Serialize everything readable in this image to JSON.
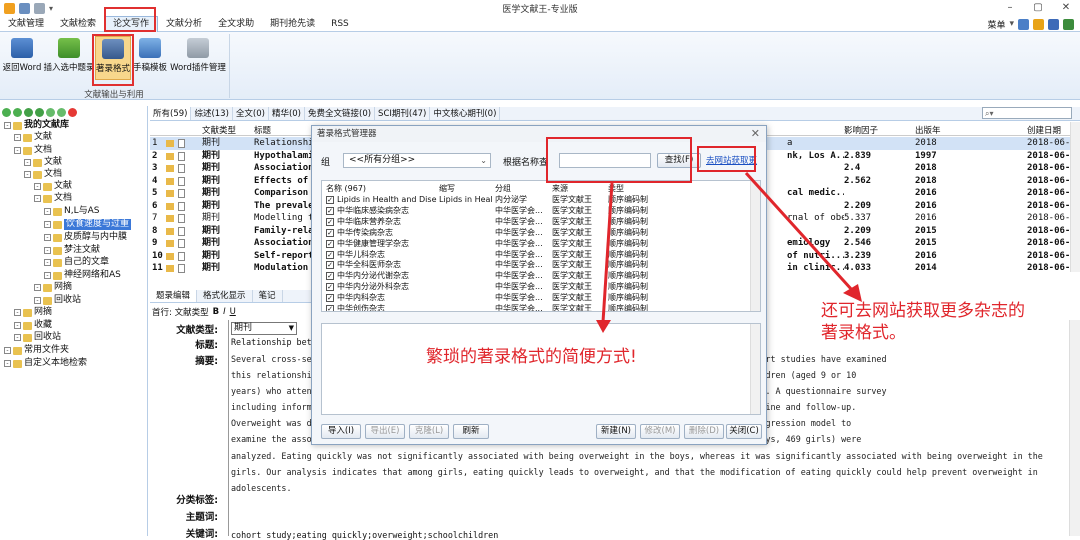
{
  "window": {
    "title": "医学文献王-专业版"
  },
  "menu": {
    "items": [
      "文献管理",
      "文献检索",
      "论文写作",
      "文献分析",
      "全文求助",
      "期刊抢先读",
      "RSS"
    ],
    "active": "论文写作",
    "right_label": "菜单"
  },
  "ribbon": {
    "buttons": [
      "返回Word",
      "插入选中题录",
      "著录格式",
      "手稿模板",
      "Word插件管理"
    ],
    "group_label": "文献输出与利用"
  },
  "sidebar": {
    "items": [
      {
        "label": "我的文献库",
        "level": 0,
        "bold": true
      },
      {
        "label": "文献",
        "level": 1
      },
      {
        "label": "文档",
        "level": 1
      },
      {
        "label": "文献",
        "level": 2
      },
      {
        "label": "文档",
        "level": 2
      },
      {
        "label": "文献",
        "level": 3
      },
      {
        "label": "文档",
        "level": 3
      },
      {
        "label": "N,L与AS",
        "level": 4
      },
      {
        "label": "饮食速度与过重",
        "level": 4,
        "selected": true
      },
      {
        "label": "皮质醇与内中膜",
        "level": 4
      },
      {
        "label": "梦注文献",
        "level": 4
      },
      {
        "label": "自己的文章",
        "level": 4
      },
      {
        "label": "神经网络和AS",
        "level": 4
      },
      {
        "label": "网摘",
        "level": 3
      },
      {
        "label": "回收站",
        "level": 3
      },
      {
        "label": "网摘",
        "level": 1
      },
      {
        "label": "收藏",
        "level": 1
      },
      {
        "label": "回收站",
        "level": 1
      },
      {
        "label": "常用文件夹",
        "level": 0
      },
      {
        "label": "自定义本地检索",
        "level": 0
      }
    ]
  },
  "tabs": [
    "所有(59)",
    "综述(13)",
    "全文(0)",
    "精华(0)",
    "免费全文链接(0)",
    "SCI期刊(47)",
    "中文核心期刊(0)"
  ],
  "grid": {
    "headers": {
      "type": "文献类型",
      "title": "标题",
      "impact": "影响因子",
      "year": "出版年",
      "created": "创建日期"
    },
    "rows": [
      {
        "n": "1",
        "type": "期刊",
        "title": "Relationship",
        "tail": "a",
        "impact": "",
        "year": "2018",
        "created": "2018-06-",
        "bold": false
      },
      {
        "n": "2",
        "type": "期刊",
        "title": "Hypothalami",
        "tail": "nk, Los A...",
        "impact": "2.839",
        "year": "1997",
        "created": "2018-06-",
        "bold": true
      },
      {
        "n": "3",
        "type": "期刊",
        "title": "Association",
        "tail": "",
        "impact": "2.4",
        "year": "2018",
        "created": "2018-06-",
        "bold": true
      },
      {
        "n": "4",
        "type": "期刊",
        "title": "Effects of",
        "tail": "",
        "impact": "2.562",
        "year": "2018",
        "created": "2018-06-",
        "bold": true
      },
      {
        "n": "5",
        "type": "期刊",
        "title": "Comparison",
        "tail": "cal medic...",
        "impact": "",
        "year": "2016",
        "created": "2018-06-",
        "bold": true
      },
      {
        "n": "6",
        "type": "期刊",
        "title": "The prevalen",
        "tail": "",
        "impact": "2.209",
        "year": "2016",
        "created": "2018-06-",
        "bold": true
      },
      {
        "n": "7",
        "type": "期刊",
        "title": "Modelling th",
        "tail": "rnal of obe...",
        "impact": "5.337",
        "year": "2016",
        "created": "2018-06-(",
        "bold": false
      },
      {
        "n": "8",
        "type": "期刊",
        "title": "Family-rela",
        "tail": "",
        "impact": "2.209",
        "year": "2015",
        "created": "2018-06-",
        "bold": true
      },
      {
        "n": "9",
        "type": "期刊",
        "title": "Association",
        "tail": "emiology",
        "impact": "2.546",
        "year": "2015",
        "created": "2018-06-",
        "bold": true
      },
      {
        "n": "10",
        "type": "期刊",
        "title": "Self-report",
        "tail": "of nutri...",
        "impact": "3.239",
        "year": "2016",
        "created": "2018-06-",
        "bold": true
      },
      {
        "n": "11",
        "type": "期刊",
        "title": "Modulation",
        "tail": "in clinic...",
        "impact": "4.033",
        "year": "2014",
        "created": "2018-06-",
        "bold": true
      }
    ]
  },
  "detail": {
    "tabs": [
      "题录编辑",
      "格式化显示",
      "笔记"
    ],
    "first_label": "首行: 文献类型",
    "fields": {
      "type_label": "文献类型:",
      "type_value": "期刊",
      "title_label": "标题:",
      "abstract_label": "摘要:",
      "category_label": "分类标签:",
      "subject_label": "主题词:",
      "keyword_label": "关键词:"
    },
    "title_value": "Relationship bet",
    "abstract_lines": [
      "Several cross-se                                                        and adolescents. However, few cohort studies have examined",
      "this relationshi                                                        t study of fourth-grade schoolchildren (aged 9 or 10",
      "years) who atten                                                        01-2004 (at baseline) to 2004-2007. A questionnaire survey",
      "including inform                                                        easurements were obtained at baseline and follow-up.",
      "Overweight was d                                                        y Task Force. We used a Poisson regression model to",
      "examine the asso                                                        34 non-overweight children (465 boys, 469 girls) were",
      "analyzed. Eating quickly was not significantly associated with being overweight in the boys, whereas it was significantly associated with being overweight in the",
      "girls. Our analysis indicates that among girls, eating quickly leads to overweight, and that the modification of eating quickly could help prevent overweight in",
      "adolescents."
    ],
    "keywords_value": "cohort study;eating quickly;overweight;schoolchildren"
  },
  "dialog": {
    "title": "著录格式管理器",
    "group_label": "组",
    "group_value": "<<所有分组>>",
    "search_label": "根据名称查",
    "search_button": "查找(F)",
    "link": "去网站获取更",
    "list_headers": [
      "名称 (967)",
      "缩写",
      "分组",
      "来源",
      "类型"
    ],
    "items": [
      {
        "name": "Lipids in Health and Disease",
        "abbr": "Lipids in Heal...",
        "group": "内分泌学",
        "source": "医学文献王",
        "type": "顺序编码制"
      },
      {
        "name": "中华临床感染病杂志",
        "abbr": "",
        "group": "中华医学会...",
        "source": "医学文献王",
        "type": "顺序编码制"
      },
      {
        "name": "中华临床营养杂志",
        "abbr": "",
        "group": "中华医学会...",
        "source": "医学文献王",
        "type": "顺序编码制"
      },
      {
        "name": "中华传染病杂志",
        "abbr": "",
        "group": "中华医学会...",
        "source": "医学文献王",
        "type": "顺序编码制"
      },
      {
        "name": "中华健康管理学杂志",
        "abbr": "",
        "group": "中华医学会...",
        "source": "医学文献王",
        "type": "顺序编码制"
      },
      {
        "name": "中华儿科杂志",
        "abbr": "",
        "group": "中华医学会...",
        "source": "医学文献王",
        "type": "顺序编码制"
      },
      {
        "name": "中华全科医师杂志",
        "abbr": "",
        "group": "中华医学会...",
        "source": "医学文献王",
        "type": "顺序编码制"
      },
      {
        "name": "中华内分泌代谢杂志",
        "abbr": "",
        "group": "中华医学会...",
        "source": "医学文献王",
        "type": "顺序编码制"
      },
      {
        "name": "中华内分泌外科杂志",
        "abbr": "",
        "group": "中华医学会...",
        "source": "医学文献王",
        "type": "顺序编码制"
      },
      {
        "name": "中华内科杂志",
        "abbr": "",
        "group": "中华医学会...",
        "source": "医学文献王",
        "type": "顺序编码制"
      },
      {
        "name": "中华创伤杂志",
        "abbr": "",
        "group": "中华医学会...",
        "source": "医学文献王",
        "type": "顺序编码制"
      }
    ],
    "buttons": {
      "import": "导入(I)",
      "export": "导出(E)",
      "clone": "克隆(L)",
      "refresh": "刷新",
      "new": "新建(N)",
      "edit": "修改(M)",
      "delete": "删除(D)",
      "close": "关闭(C)"
    }
  },
  "annotations": {
    "center": "繁琐的著录格式的简便方式!",
    "right_line1": "还可去网站获取更多杂志的",
    "right_line2": "著录格式。"
  },
  "colors": {
    "accent": "#3b78d8",
    "annotation": "#e0262c",
    "ribbon_bg": "#e4edf8"
  }
}
